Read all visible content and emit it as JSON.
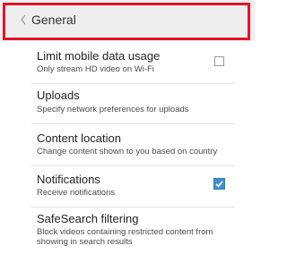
{
  "header": {
    "title": "General",
    "highlight_color": "#e3132b",
    "back_icon": "chevron-left-icon"
  },
  "settings": [
    {
      "title": "Limit mobile data usage",
      "subtitle": "Only stream HD video on Wi-Fi",
      "control": "checkbox",
      "checked": false
    },
    {
      "title": "Uploads",
      "subtitle": "Specify network preferences for uploads"
    },
    {
      "title": "Content location",
      "subtitle": "Change content shown to you based on country"
    },
    {
      "title": "Notifications",
      "subtitle": "Receive notifications",
      "control": "checkbox",
      "checked": true
    },
    {
      "title": "SafeSearch filtering",
      "subtitle_line1": "Block videos containing restricted content from",
      "subtitle_line2": "showing in search results"
    }
  ],
  "colors": {
    "checkbox_checked": "#3b8ed8",
    "header_background": "#eeeeee",
    "divider": "#e4e4e4"
  }
}
